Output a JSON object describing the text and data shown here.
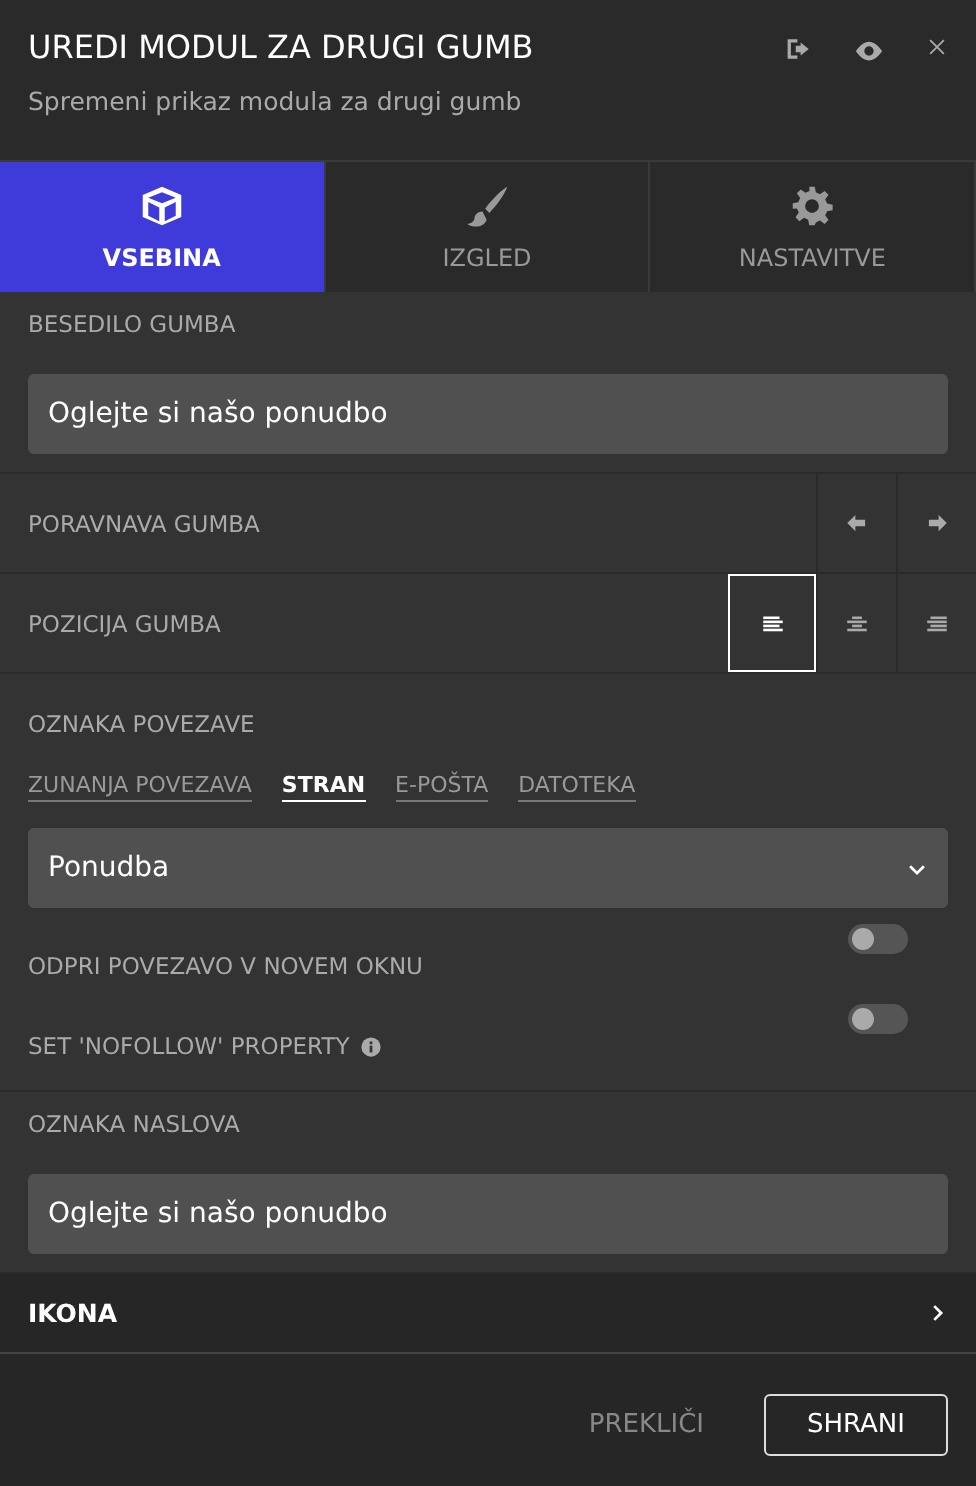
{
  "header": {
    "title": "UREDI MODUL ZA DRUGI GUMB",
    "subtitle": "Spremeni prikaz modula za drugi gumb"
  },
  "tabs": [
    {
      "label": "VSEBINA",
      "kind": "cube",
      "selected": true
    },
    {
      "label": "IZGLED",
      "kind": "brush",
      "selected": false
    },
    {
      "label": "NASTAVITVE",
      "kind": "gear",
      "selected": false
    }
  ],
  "button_text": {
    "label": "BESEDILO GUMBA",
    "value": "Oglejte si našo ponudbo"
  },
  "alignment": {
    "label": "PORAVNAVA GUMBA",
    "options": [
      {
        "kind": "left",
        "selected": false
      },
      {
        "kind": "right",
        "selected": false
      }
    ]
  },
  "position": {
    "label": "POZICIJA GUMBA",
    "options": [
      {
        "kind": "left",
        "selected": true
      },
      {
        "kind": "center",
        "selected": false
      },
      {
        "kind": "right",
        "selected": false
      }
    ]
  },
  "link": {
    "label": "OZNAKA POVEZAVE",
    "types": [
      {
        "label": "ZUNANJA POVEZAVA",
        "selected": false
      },
      {
        "label": "STRAN",
        "selected": true
      },
      {
        "label": "E-POŠTA",
        "selected": false
      },
      {
        "label": "DATOTEKA",
        "selected": false
      }
    ],
    "page": "Ponudba",
    "toggles": [
      {
        "label": "ODPRI POVEZAVO V NOVEM OKNU",
        "on": false,
        "info": false
      },
      {
        "label": "SET 'NOFOLLOW' PROPERTY",
        "on": false,
        "info": true
      }
    ]
  },
  "title_tag": {
    "label": "OZNAKA NASLOVA",
    "value": "Oglejte si našo ponudbo"
  },
  "icon_section": {
    "label": "IKONA",
    "expanded": false
  },
  "footer": {
    "cancel": "PREKLIČI",
    "save": "SHRANI"
  }
}
